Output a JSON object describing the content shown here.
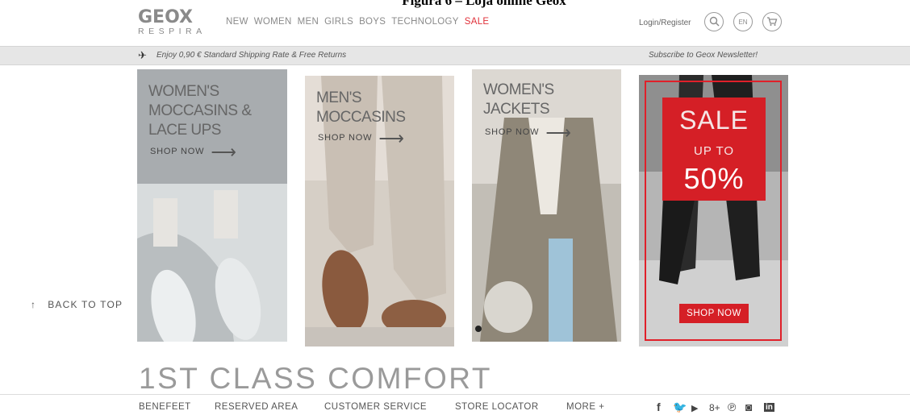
{
  "caption": "Figura 6 – Loja online Geox",
  "header": {
    "logo_main": "GEOX",
    "logo_sub": "RESPIRA",
    "nav": [
      "NEW",
      "WOMEN",
      "MEN",
      "GIRLS",
      "BOYS",
      "TECHNOLOGY"
    ],
    "nav_sale": "SALE",
    "login": "Login/Register",
    "language": "EN",
    "icons": [
      "search-icon",
      "cart-icon"
    ]
  },
  "shipbar": {
    "text": "Enjoy 0,90 € Standard Shipping Rate & Free Returns",
    "newsletter": "Subscribe to Geox Newsletter!"
  },
  "back_to_top": {
    "arrow": "↑",
    "label": "BACK TO TOP"
  },
  "tiles": [
    {
      "lines": [
        "WOMEN'S",
        "MOCCASINS &",
        "LACE UPS"
      ],
      "shop": "SHOP NOW",
      "arrow": "⟶"
    },
    {
      "lines": [
        "MEN'S",
        "MOCCASINS"
      ],
      "shop": "SHOP NOW",
      "arrow": "⟶"
    },
    {
      "lines": [
        "WOMEN'S",
        "JACKETS"
      ],
      "shop": "SHOP NOW",
      "arrow": "⟶"
    },
    {
      "sale": "SALE",
      "up_to": "UP TO",
      "percent": "50%",
      "shop": "SHOP NOW"
    }
  ],
  "footer": {
    "headline": "1ST CLASS COMFORT",
    "links": [
      "BENEFEET",
      "RESERVED AREA",
      "CUSTOMER SERVICE",
      "STORE LOCATOR",
      "MORE +"
    ],
    "social": [
      "f",
      "🐦",
      "▶",
      "8+",
      "℗",
      "◙",
      "in"
    ]
  },
  "colors": {
    "sale_red": "#e0313a",
    "accent_red": "#d4202a",
    "text_grey": "#8a8a8a"
  }
}
